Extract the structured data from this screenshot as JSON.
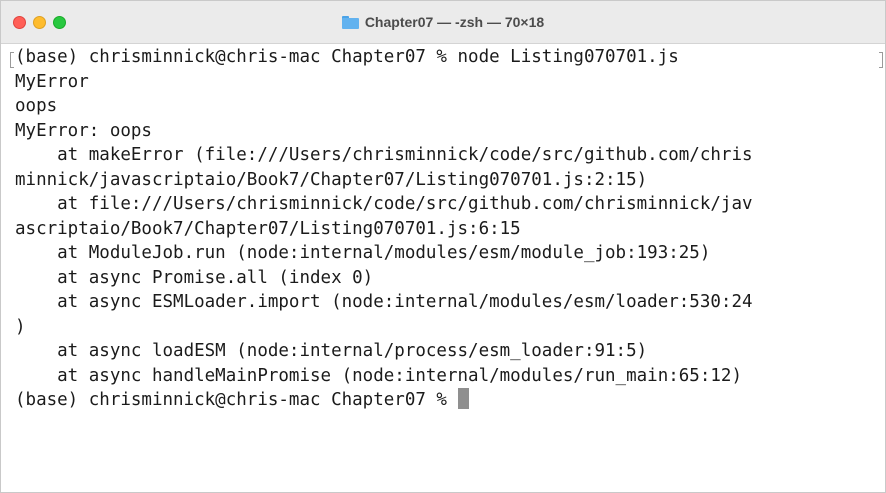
{
  "window": {
    "title": "Chapter07 — -zsh — 70×18",
    "title_icon": "folder-icon"
  },
  "terminal": {
    "lines": [
      "(base) chrisminnick@chris-mac Chapter07 % node Listing070701.js",
      "MyError",
      "oops",
      "MyError: oops",
      "    at makeError (file:///Users/chrisminnick/code/src/github.com/chris",
      "minnick/javascriptaio/Book7/Chapter07/Listing070701.js:2:15)",
      "    at file:///Users/chrisminnick/code/src/github.com/chrisminnick/jav",
      "ascriptaio/Book7/Chapter07/Listing070701.js:6:15",
      "    at ModuleJob.run (node:internal/modules/esm/module_job:193:25)",
      "    at async Promise.all (index 0)",
      "    at async ESMLoader.import (node:internal/modules/esm/loader:530:24",
      ")",
      "    at async loadESM (node:internal/process/esm_loader:91:5)",
      "    at async handleMainPromise (node:internal/modules/run_main:65:12)"
    ],
    "prompt": "(base) chrisminnick@chris-mac Chapter07 % "
  },
  "colors": {
    "titlebar_bg": "#ebebeb",
    "close": "#ff5f57",
    "minimize": "#febc2e",
    "maximize": "#28c840",
    "text": "#1b1b1b",
    "cursor": "#8f8f8f"
  }
}
